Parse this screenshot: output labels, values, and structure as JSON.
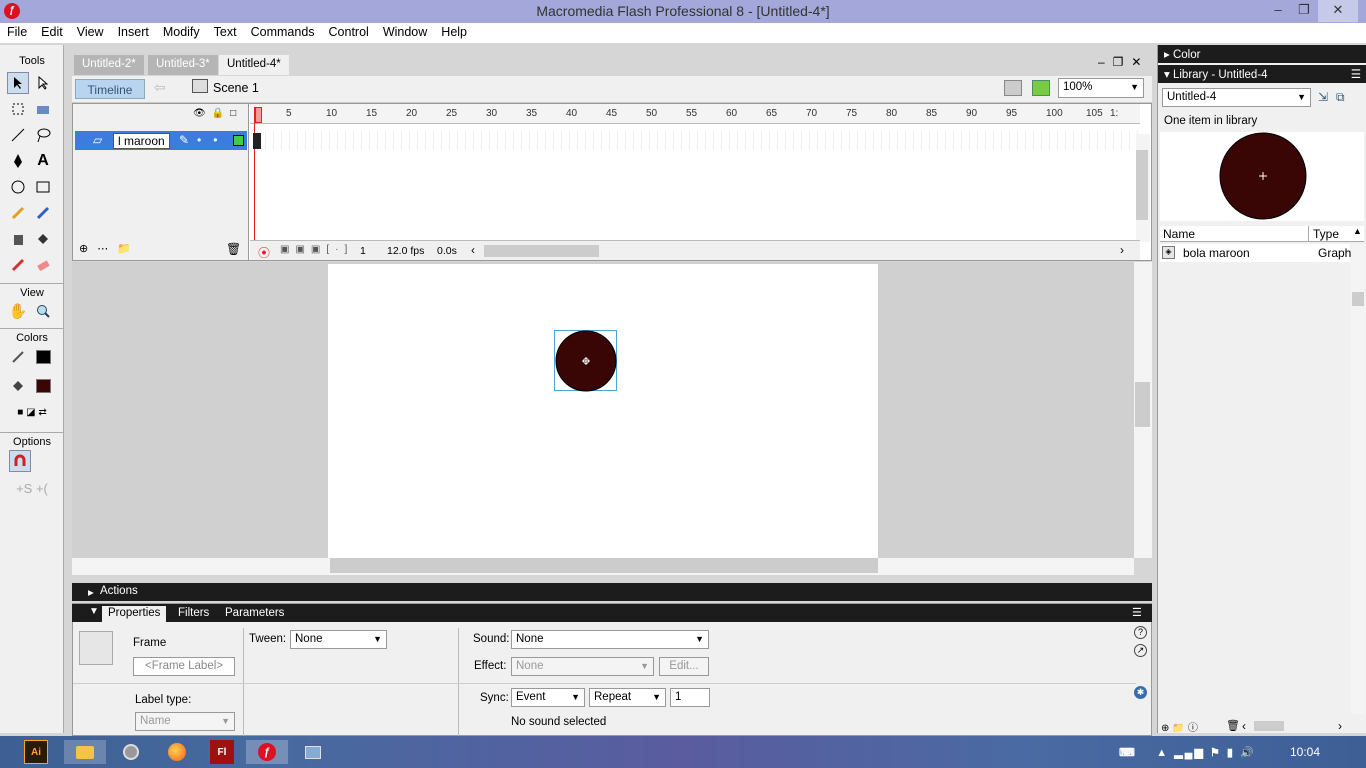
{
  "window": {
    "title": "Macromedia Flash Professional 8 - [Untitled-4*]",
    "minimize": "–",
    "restore": "❐",
    "close": "✕"
  },
  "menu": [
    "File",
    "Edit",
    "View",
    "Insert",
    "Modify",
    "Text",
    "Commands",
    "Control",
    "Window",
    "Help"
  ],
  "tools": {
    "title": "Tools",
    "view": "View",
    "colors": "Colors",
    "options": "Options"
  },
  "doc_tabs": [
    "Untitled-2*",
    "Untitled-3*",
    "Untitled-4*"
  ],
  "timeline": {
    "button": "Timeline",
    "scene": "Scene 1",
    "zoom": "100%",
    "layer_name": "l maroon",
    "ruler": [
      "1",
      "5",
      "10",
      "15",
      "20",
      "25",
      "30",
      "35",
      "40",
      "45",
      "50",
      "55",
      "60",
      "65",
      "70",
      "75",
      "80",
      "85",
      "90",
      "95",
      "100",
      "105",
      "1:"
    ],
    "frame": "1",
    "fps": "12.0 fps",
    "time": "0.0s"
  },
  "actions": {
    "label": "Actions"
  },
  "properties": {
    "tabs": [
      "Properties",
      "Filters",
      "Parameters"
    ],
    "frame_label": "Frame",
    "frame_label_placeholder": "<Frame Label>",
    "label_type_label": "Label type:",
    "label_type_value": "Name",
    "tween_label": "Tween:",
    "tween_value": "None",
    "sound_label": "Sound:",
    "sound_value": "None",
    "effect_label": "Effect:",
    "effect_value": "None",
    "edit_button": "Edit...",
    "sync_label": "Sync:",
    "sync_value": "Event",
    "repeat_value": "Repeat",
    "repeat_count": "1",
    "sound_status": "No sound selected"
  },
  "right_panel": {
    "color_header": "Color",
    "library_header": "Library - Untitled-4",
    "library_select": "Untitled-4",
    "item_count": "One item in library",
    "col_name": "Name",
    "col_type": "Type",
    "item_name": "bola maroon",
    "item_type": "Graph"
  },
  "taskbar": {
    "clock": "10:04"
  },
  "colors": {
    "fill": "#3a0505",
    "stroke": "#000000",
    "accent": "#6aa7e0"
  }
}
